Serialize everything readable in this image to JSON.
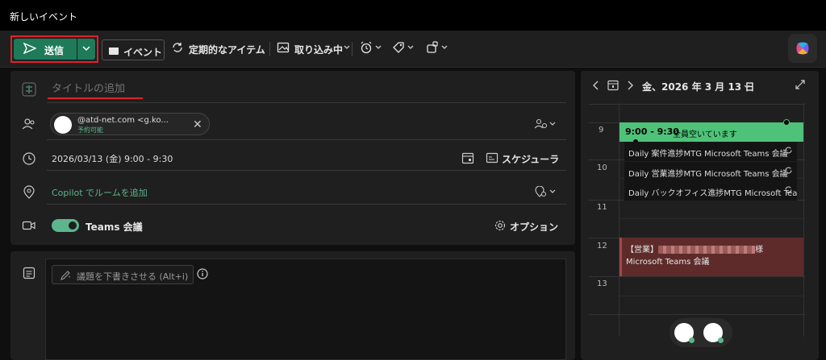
{
  "window": {
    "title": "新しいイベント"
  },
  "toolbar": {
    "send_label": "送信",
    "event_label": "イベント",
    "recurring_label": "定期的なアイテム",
    "busy_label": "取り込み中"
  },
  "form": {
    "title_placeholder": "タイトルの追加",
    "attendee_email": "@atd-net.com <g.ko...",
    "attendee_status": "予約可能",
    "datetime": "2026/03/13 (金) 9:00 - 9:30",
    "scheduler_label": "スケジューラ",
    "room_label": "Copilot でルームを追加",
    "teams_label": "Teams 会議",
    "options_label": "オプション",
    "draft_label": "議題を下書きさせる (Alt+i)"
  },
  "calendar": {
    "date_label": "金、2026 年 3 月 13 日",
    "hours": [
      "9",
      "10",
      "11",
      "12",
      "13"
    ],
    "new_event": {
      "time": "9:00 - 9:30",
      "status": "全員空いています"
    },
    "daily_events": [
      {
        "label": "Daily 案件進捗MTG Microsoft Teams 会議"
      },
      {
        "label": "Daily 営業進捗MTG Microsoft Teams 会議"
      },
      {
        "label": "Daily バックオフィス進捗MTG Microsoft Teams 会"
      }
    ],
    "sales_event": {
      "prefix": "【営業】",
      "suffix": "様",
      "line2": "Microsoft Teams 会議"
    }
  },
  "colors": {
    "accent": "#1f7a5a",
    "green_event": "#4fc27a",
    "red_event": "#5e2a2a",
    "highlight_box": "#e0202a"
  }
}
